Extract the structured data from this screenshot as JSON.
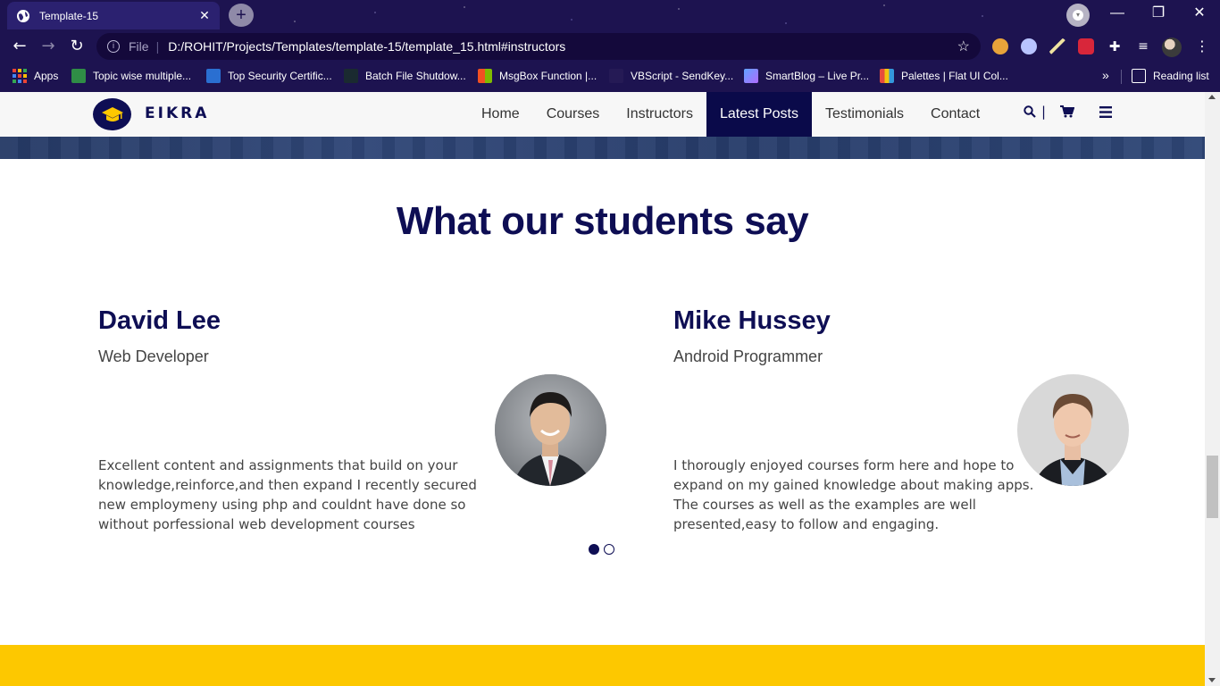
{
  "browser": {
    "tab_title": "Template-15",
    "tab_close": "✕",
    "new_tab": "+",
    "window_minimize": "—",
    "window_restore": "❐",
    "window_close": "✕",
    "address_prefix": "File",
    "address_sep": "|",
    "url": "D:/ROHIT/Projects/Templates/template-15/template_15.html#instructors",
    "star_icon": "☆",
    "bookmarks": [
      {
        "label": "Apps"
      },
      {
        "label": "Topic wise multiple..."
      },
      {
        "label": "Top Security Certific..."
      },
      {
        "label": "Batch File Shutdow..."
      },
      {
        "label": "MsgBox Function |..."
      },
      {
        "label": "VBScript - SendKey..."
      },
      {
        "label": "SmartBlog – Live Pr..."
      },
      {
        "label": "Palettes | Flat UI Col..."
      }
    ],
    "bookmarks_more": "»",
    "reading_list": "Reading list"
  },
  "site": {
    "logo_text": "EIKRA",
    "menu": [
      {
        "label": "Home",
        "active": false
      },
      {
        "label": "Courses",
        "active": false
      },
      {
        "label": "Instructors",
        "active": false
      },
      {
        "label": "Latest Posts",
        "active": true
      },
      {
        "label": "Testimonials",
        "active": false
      },
      {
        "label": "Contact",
        "active": false
      }
    ],
    "search_icon": "🔍",
    "separator": "|",
    "cart_icon": "🛒",
    "menu_icon": "≡"
  },
  "testimonials": {
    "title": "What our students say",
    "items": [
      {
        "name": "David Lee",
        "role": "Web Developer",
        "text": "Excellent content and assignments that build on your knowledge,reinforce,and then expand I recently secured new employmeny using php and couldnt have done so without porfessional web development courses"
      },
      {
        "name": "Mike Hussey",
        "role": "Android Programmer",
        "text": "I thorougly enjoyed courses form here and hope to expand on my gained knowledge about making apps. The courses as well as the examples are well presented,easy to follow and engaging."
      }
    ],
    "active_slide": 1,
    "slide_count": 2
  },
  "colors": {
    "brand_navy": "#0e0e54",
    "accent_yellow": "#fdc800",
    "browser_bg": "#1d1350"
  }
}
